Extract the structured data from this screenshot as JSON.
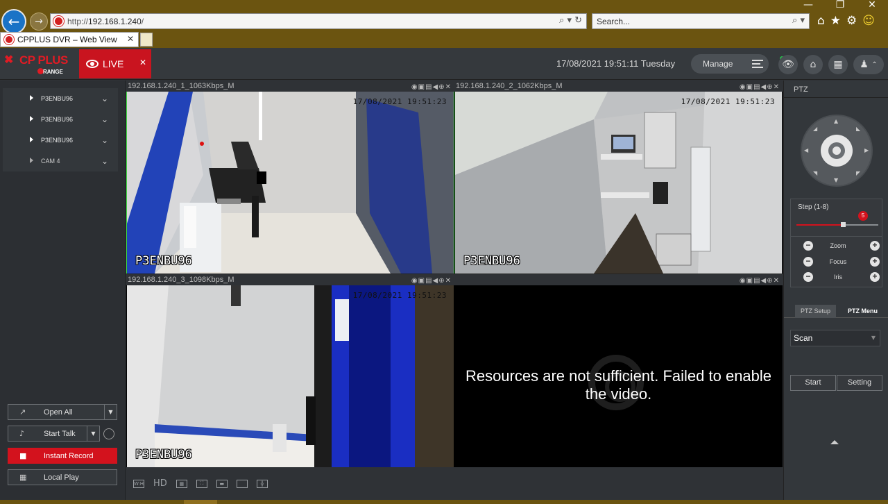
{
  "browser": {
    "url_scheme": "http://",
    "url_host": "192.168.1.240",
    "url_path": "/",
    "addr_icons": "⌕ ▾ ↻",
    "search_placeholder": "Search...",
    "search_icons": "⌕ ▾",
    "tab_title": "CPPLUS DVR – Web View",
    "chrome_icons": [
      "⌂",
      "★",
      "⚙",
      "☺"
    ],
    "window_controls": [
      "—",
      "❐",
      "✕"
    ]
  },
  "header": {
    "brand": "CP PLUS",
    "brand_sub": "RANGE",
    "live_label": "LIVE",
    "datetime": "17/08/2021 19:51:11 Tuesday",
    "manage_label": "Manage"
  },
  "sidebar": {
    "devices": [
      {
        "label": "P3ENBU96"
      },
      {
        "label": "P3ENBU96"
      },
      {
        "label": "P3ENBU96"
      },
      {
        "label": "CAM 4"
      }
    ],
    "buttons": {
      "open_all": "Open All",
      "start_talk": "Start Talk",
      "instant_record": "Instant Record",
      "local_play": "Local Play"
    }
  },
  "cameras": [
    {
      "title": "192.168.1.240_1_1063Kbps_M",
      "osd_time": "17/08/2021 19:51:23",
      "osd_name": "P3ENBU96"
    },
    {
      "title": "192.168.1.240_2_1062Kbps_M",
      "osd_time": "17/08/2021 19:51:23",
      "osd_name": "P3ENBU96"
    },
    {
      "title": "192.168.1.240_3_1098Kbps_M",
      "osd_time": "17/08/2021 19:51:23",
      "osd_name": "P3ENBU96"
    },
    {
      "title": "",
      "message": "Resources are not sufficient. Failed to enable the video."
    }
  ],
  "bottom_toolbar": {
    "hd_label": "HD"
  },
  "ptz": {
    "title": "PTZ",
    "step_label": "Step (1-8)",
    "step_value": "5",
    "step_fraction": 0.57,
    "zoom_label": "Zoom",
    "focus_label": "Focus",
    "iris_label": "Iris",
    "tab_setup": "PTZ Setup",
    "tab_menu": "PTZ Menu",
    "mode_value": "Scan",
    "start_label": "Start",
    "setting_label": "Setting"
  },
  "colors": {
    "accent_red": "#d3121d",
    "selected_cell_border": "#3fdc3f"
  }
}
